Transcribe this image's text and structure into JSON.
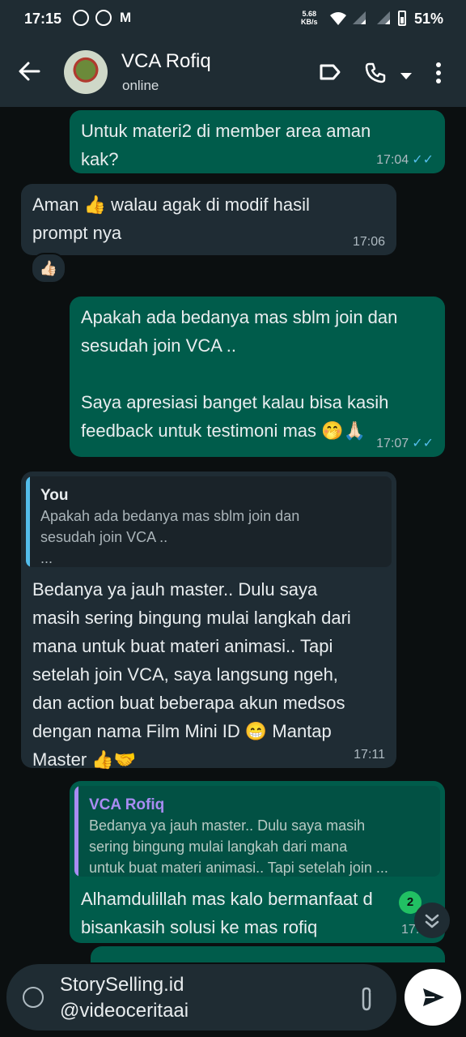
{
  "status_bar": {
    "time": "17:15",
    "notification_icons": [
      "whatsapp-icon",
      "whatsapp-icon",
      "gmail-icon"
    ],
    "gmail_letter": "M",
    "net_speed": "5.68",
    "net_unit": "KB/s",
    "battery": "51%"
  },
  "header": {
    "contact_name": "VCA Rofiq",
    "status": "online"
  },
  "messages": [
    {
      "dir": "out",
      "text": "Untuk materi2 di member area aman\nkak?",
      "time": "17:04"
    },
    {
      "dir": "in",
      "text": "Aman 👍 walau agak di modif hasil\nprompt nya",
      "time": "17:06",
      "reaction": "👍🏻"
    },
    {
      "dir": "out",
      "text": "Apakah ada bedanya mas sblm join dan\nsesudah join VCA ..\n\nSaya apresiasi banget kalau bisa kasih\nfeedback untuk testimoni mas 🤭🙏🏻",
      "time": "17:07"
    },
    {
      "dir": "in",
      "quote_author": "You",
      "quote_text": "Apakah ada bedanya mas sblm join dan\nsesudah join VCA ..\n...",
      "text": "Bedanya ya jauh master.. Dulu saya\nmasih sering bingung mulai langkah dari\nmana untuk buat materi animasi.. Tapi\nsetelah join VCA, saya langsung ngeh,\ndan action buat beberapa akun medsos\ndengan nama Film Mini ID 😁 Mantap\nMaster 👍🤝",
      "time": "17:11"
    },
    {
      "dir": "out",
      "quote_author": "VCA Rofiq",
      "quote_text": "Bedanya ya jauh master.. Dulu saya masih\nsering bingung mulai langkah dari mana\nuntuk buat materi animasi.. Tapi setelah join ...",
      "text": "Alhamdulillah mas kalo bermanfaat d\nbisankasih solusi ke mas rofiq",
      "time": "17:13"
    }
  ],
  "unread_count": "2",
  "composer": {
    "text": "StorySelling.id\n@videoceritaai"
  },
  "colors": {
    "outgoing_bubble": "#005c4b",
    "incoming_bubble": "#1f2c34",
    "read_ticks": "#53bdeb",
    "quote_you": "#53bdeb",
    "quote_contact": "#a98cf3"
  }
}
